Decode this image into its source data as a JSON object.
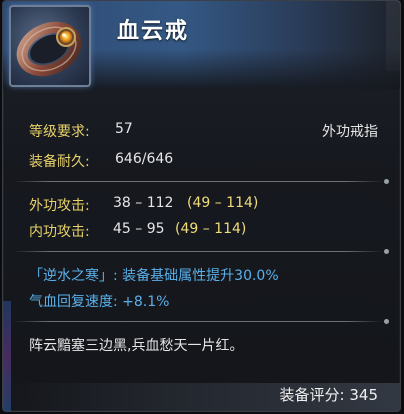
{
  "item": {
    "name": "血云戒",
    "icon": "ring-icon",
    "level_label": "等级要求:",
    "level_value": "57",
    "type": "外功戒指",
    "durability_label": "装备耐久:",
    "durability_value": "646/646"
  },
  "attacks": [
    {
      "label": "外功攻击:",
      "value": "38  –  112",
      "range": "(49  –  114)"
    },
    {
      "label": "内功攻击:",
      "value": "45  –  95",
      "range": "(49  –  114)"
    }
  ],
  "effects": {
    "set_line": "「逆水之寒」: 装备基础属性提升30.0%",
    "regen_line": "气血回复速度: +8.1%"
  },
  "flavor": "阵云黯塞三边黑,兵血愁天一片红。",
  "footer": {
    "score_label": "装备评分:",
    "score_value": "345"
  },
  "colors": {
    "label_yellow": "#e8d26a",
    "effect_blue": "#5ab0ea",
    "header_blue": "#345884"
  }
}
